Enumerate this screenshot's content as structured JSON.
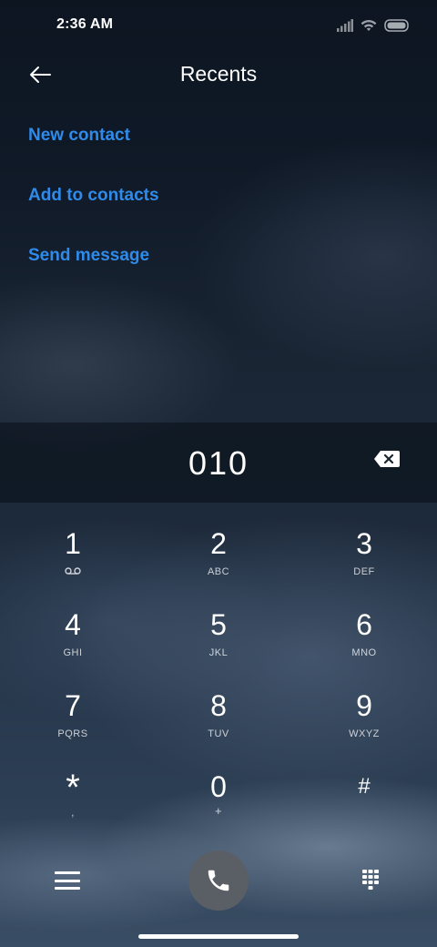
{
  "status_bar": {
    "time": "2:36 AM",
    "icons": [
      "signal-icon",
      "wifi-icon",
      "battery-icon"
    ]
  },
  "header": {
    "title": "Recents",
    "back_icon": "arrow-left-icon"
  },
  "menu": {
    "items": [
      {
        "label": "New contact"
      },
      {
        "label": "Add to contacts"
      },
      {
        "label": "Send message"
      }
    ],
    "accent_color": "#2f8bea"
  },
  "dialer": {
    "number": "010",
    "backspace_icon": "backspace-icon"
  },
  "keypad": {
    "keys": [
      {
        "digit": "1",
        "letters": "",
        "icon": "voicemail-icon"
      },
      {
        "digit": "2",
        "letters": "ABC"
      },
      {
        "digit": "3",
        "letters": "DEF"
      },
      {
        "digit": "4",
        "letters": "GHI"
      },
      {
        "digit": "5",
        "letters": "JKL"
      },
      {
        "digit": "6",
        "letters": "MNO"
      },
      {
        "digit": "7",
        "letters": "PQRS"
      },
      {
        "digit": "8",
        "letters": "TUV"
      },
      {
        "digit": "9",
        "letters": "WXYZ"
      },
      {
        "digit": "*",
        "letters": ","
      },
      {
        "digit": "0",
        "letters": "+"
      },
      {
        "digit": "#",
        "letters": ""
      }
    ]
  },
  "bottom_bar": {
    "menu_icon": "hamburger-icon",
    "call_icon": "phone-icon",
    "dialpad_icon": "dialpad-icon",
    "call_button_color": "#5a5f66"
  }
}
